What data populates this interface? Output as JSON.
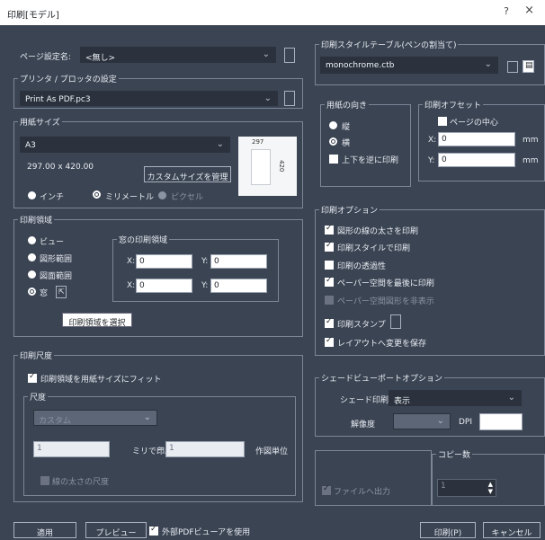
{
  "window": {
    "title": "印刷[モデル]",
    "help": "?",
    "close": "×"
  },
  "page_setup": {
    "label": "ページ設定名:",
    "value": "<無し>"
  },
  "printer": {
    "legend": "プリンタ / プロッタの設定",
    "value": "Print As PDF.pc3"
  },
  "paper_size": {
    "legend": "用紙サイズ",
    "value": "A3",
    "dimensions": "297.00 x 420.00",
    "manage_button": "カスタムサイズを管理",
    "units": [
      "インチ",
      "ミリメートル",
      "ピクセル"
    ],
    "preview_width": "297",
    "preview_height": "420"
  },
  "print_area": {
    "legend": "印刷領域",
    "options": [
      "ビュー",
      "図形範囲",
      "図面範囲",
      "窓"
    ],
    "window_legend": "窓の印刷領域",
    "x1": "0",
    "y1": "0",
    "x2": "0",
    "y2": "0",
    "x_label": "X:",
    "y_label": "Y:",
    "tooltip": "印刷領域を選択"
  },
  "scale": {
    "legend": "印刷尺度",
    "fit_label": "印刷領域を用紙サイズにフィット",
    "scale_legend": "尺度",
    "scale_value": "カスタム",
    "value1": "1",
    "unit_label": "ミリで印刷",
    "equals": "=",
    "value2": "1",
    "drawing_units": "作図単位",
    "lineweight_label": "線の太さの尺度"
  },
  "bottom": {
    "apply": "適用",
    "preview": "プレビュー",
    "external_pdf": "外部PDFビューアを使用",
    "print": "印刷(P)",
    "cancel": "キャンセル"
  },
  "style_table": {
    "legend": "印刷スタイルテーブル(ペンの割当て)",
    "value": "monochrome.ctb"
  },
  "orientation": {
    "legend": "用紙の向き",
    "options": [
      "縦",
      "横"
    ],
    "upside_down": "上下を逆に印刷"
  },
  "offset": {
    "legend": "印刷オフセット",
    "center_label": "ページの中心",
    "x_label": "X:",
    "x_value": "0",
    "y_label": "Y:",
    "y_value": "0",
    "unit": "mm"
  },
  "options": {
    "legend": "印刷オプション",
    "items": [
      "図形の線の太さを印刷",
      "印刷スタイルで印刷",
      "印刷の透過性",
      "ペーパー空間を最後に印刷",
      "ペーパー空間図形を非表示",
      "印刷スタンプ",
      "レイアウトへ変更を保存"
    ]
  },
  "shade": {
    "legend": "シェードビューポートオプション",
    "shade_label": "シェード印刷",
    "shade_value": "表示",
    "res_label": "解像度",
    "dpi_label": "DPI"
  },
  "file_output": {
    "label": "ファイルへ出力"
  },
  "copies": {
    "legend": "コピー数",
    "value": "1"
  }
}
